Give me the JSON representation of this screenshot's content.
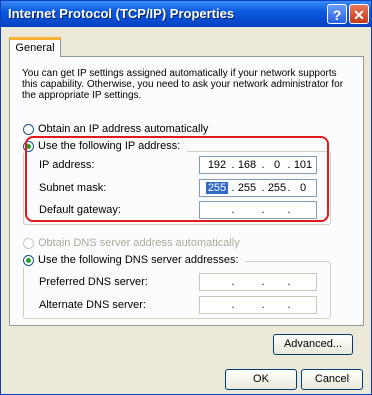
{
  "window": {
    "title": "Internet Protocol (TCP/IP) Properties",
    "help_label": "?",
    "close_label": "✕"
  },
  "tabs": [
    {
      "label": "General"
    }
  ],
  "intro_text": "You can get IP settings assigned automatically if your network supports this capability. Otherwise, you need to ask your network administrator for the appropriate IP settings.",
  "ip_mode": {
    "auto_label": "Obtain an IP address automatically",
    "manual_label": "Use the following IP address:"
  },
  "ip_fields": {
    "ip_address": {
      "label": "IP address:",
      "octets": [
        "192",
        "168",
        "0",
        "101"
      ]
    },
    "subnet_mask": {
      "label": "Subnet mask:",
      "octets": [
        "255",
        "255",
        "255",
        "0"
      ]
    },
    "default_gateway": {
      "label": "Default gateway:",
      "octets": [
        "",
        "",
        "",
        ""
      ]
    }
  },
  "dns_mode": {
    "auto_label": "Obtain DNS server address automatically",
    "manual_label": "Use the following DNS server addresses:"
  },
  "dns_fields": {
    "preferred": {
      "label": "Preferred DNS server:",
      "octets": [
        "",
        "",
        "",
        ""
      ]
    },
    "alternate": {
      "label": "Alternate DNS server:",
      "octets": [
        "",
        "",
        "",
        ""
      ]
    }
  },
  "buttons": {
    "advanced": "Advanced...",
    "ok": "OK",
    "cancel": "Cancel"
  },
  "colors": {
    "titlebar": "#0b5ae0",
    "highlight_box": "#e01a1a",
    "radio_selected": "#21a121"
  }
}
